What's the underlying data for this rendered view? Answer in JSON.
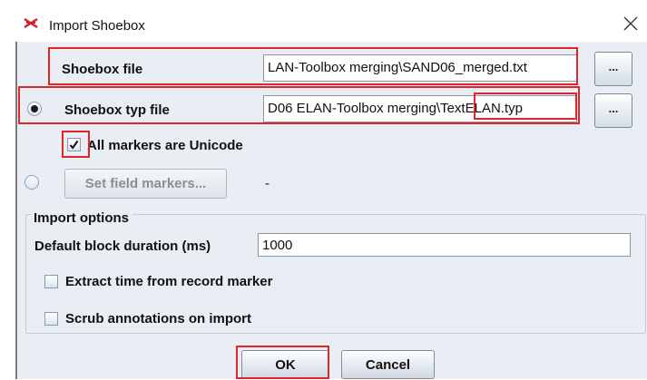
{
  "window": {
    "title": "Import Shoebox",
    "icon": "elan-scissors-icon",
    "close_icon": "close-icon"
  },
  "shoebox_file": {
    "label": "Shoebox file",
    "value": "LAN-Toolbox merging\\SAND06_merged.txt",
    "browse_label": "..."
  },
  "shoebox_typ_file": {
    "label": "Shoebox typ file",
    "value": "D06 ELAN-Toolbox merging\\TextELAN.typ",
    "browse_label": "...",
    "selected": true
  },
  "all_markers_unicode": {
    "label": "All markers are Unicode",
    "checked": true
  },
  "field_markers": {
    "button_label": "Set field markers...",
    "value": "-",
    "selected": false
  },
  "import_options": {
    "legend": "Import options",
    "duration_label": "Default block duration (ms)",
    "duration_value": "1000",
    "extract_time_label": "Extract time from record marker",
    "extract_time_checked": false,
    "scrub_label": "Scrub annotations on import",
    "scrub_checked": false
  },
  "footer": {
    "ok_label": "OK",
    "cancel_label": "Cancel"
  },
  "colors": {
    "highlight": "#e0262a",
    "dialog_bg": "#e8eef4"
  }
}
